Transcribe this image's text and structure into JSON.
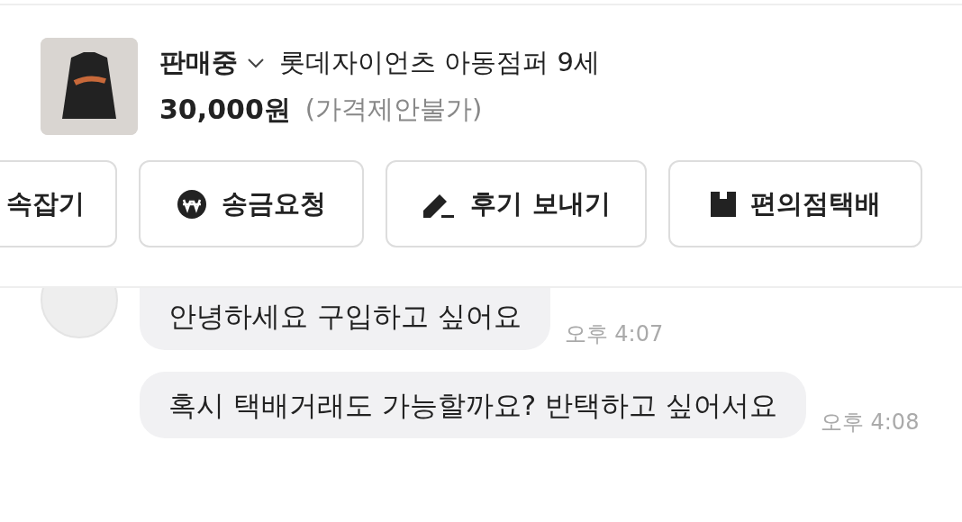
{
  "product": {
    "status": "판매중",
    "title": "롯데자이언츠 아동점퍼 9세",
    "price": "30,000원",
    "price_note": "(가격제안불가)"
  },
  "actions": [
    {
      "kind": "plain",
      "label": "속잡기"
    },
    {
      "kind": "won",
      "label": "송금요청"
    },
    {
      "kind": "pen",
      "label": "후기 보내기"
    },
    {
      "kind": "box",
      "label": "편의점택배"
    }
  ],
  "messages": [
    {
      "text": "안녕하세요 구입하고 싶어요",
      "time": "오후 4:07",
      "avatar": true
    },
    {
      "text": "혹시 택배거래도 가능할까요? 반택하고 싶어서요",
      "time": "오후 4:08",
      "avatar": false
    }
  ]
}
